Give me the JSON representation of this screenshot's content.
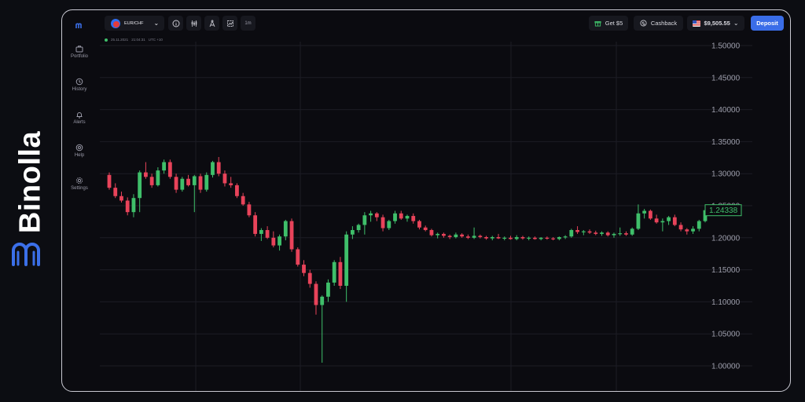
{
  "brand": {
    "word": "Binolla",
    "accent": "#3b6fe8"
  },
  "sidebar": {
    "items": [
      {
        "label": "Portfolio",
        "icon": "briefcase-icon"
      },
      {
        "label": "History",
        "icon": "history-icon"
      },
      {
        "label": "Alerts",
        "icon": "bell-icon"
      },
      {
        "label": "Help",
        "icon": "help-icon"
      },
      {
        "label": "Settings",
        "icon": "gear-icon"
      }
    ]
  },
  "topbar": {
    "pair": "EUR/CHF",
    "timeframe": "1m",
    "get_bonus": "Get $5",
    "cashback": "Cashback",
    "balance": "$9,505.55",
    "deposit": "Deposit"
  },
  "chart_header": {
    "date": "25.11.2021",
    "time": "21:04:31",
    "timezone": "UTC +10"
  },
  "chart_data": {
    "type": "candlestick",
    "y_ticks": [
      "1.50000",
      "1.45000",
      "1.40000",
      "1.35000",
      "1.30000",
      "1.25000",
      "1.20000",
      "1.15000",
      "1.10000",
      "1.05000",
      "1.00000"
    ],
    "ylim": [
      0.99,
      1.51
    ],
    "current_price": "1.24338",
    "colors": {
      "up": "#3fbf6a",
      "down": "#e8435a",
      "grid": "#1c1d25"
    },
    "candles": [
      [
        1.298,
        1.302,
        1.275,
        1.278
      ],
      [
        1.278,
        1.285,
        1.262,
        1.265
      ],
      [
        1.265,
        1.272,
        1.255,
        1.258
      ],
      [
        1.258,
        1.263,
        1.235,
        1.24
      ],
      [
        1.24,
        1.268,
        1.232,
        1.262
      ],
      [
        1.262,
        1.305,
        1.24,
        1.302
      ],
      [
        1.302,
        1.318,
        1.292,
        1.295
      ],
      [
        1.295,
        1.3,
        1.278,
        1.282
      ],
      [
        1.282,
        1.31,
        1.28,
        1.305
      ],
      [
        1.305,
        1.322,
        1.3,
        1.318
      ],
      [
        1.318,
        1.322,
        1.292,
        1.295
      ],
      [
        1.295,
        1.3,
        1.27,
        1.275
      ],
      [
        1.275,
        1.295,
        1.272,
        1.292
      ],
      [
        1.292,
        1.298,
        1.28,
        1.282
      ],
      [
        1.282,
        1.298,
        1.24,
        1.296
      ],
      [
        1.296,
        1.3,
        1.27,
        1.275
      ],
      [
        1.275,
        1.302,
        1.272,
        1.298
      ],
      [
        1.298,
        1.32,
        1.294,
        1.318
      ],
      [
        1.318,
        1.326,
        1.296,
        1.3
      ],
      [
        1.3,
        1.305,
        1.28,
        1.285
      ],
      [
        1.285,
        1.295,
        1.278,
        1.282
      ],
      [
        1.282,
        1.285,
        1.262,
        1.265
      ],
      [
        1.265,
        1.27,
        1.25,
        1.252
      ],
      [
        1.252,
        1.256,
        1.232,
        1.235
      ],
      [
        1.235,
        1.24,
        1.202,
        1.206
      ],
      [
        1.206,
        1.215,
        1.195,
        1.212
      ],
      [
        1.212,
        1.218,
        1.198,
        1.2
      ],
      [
        1.2,
        1.21,
        1.185,
        1.188
      ],
      [
        1.188,
        1.205,
        1.18,
        1.202
      ],
      [
        1.202,
        1.228,
        1.196,
        1.226
      ],
      [
        1.226,
        1.23,
        1.178,
        1.182
      ],
      [
        1.182,
        1.185,
        1.155,
        1.158
      ],
      [
        1.158,
        1.165,
        1.14,
        1.145
      ],
      [
        1.145,
        1.15,
        1.122,
        1.128
      ],
      [
        1.128,
        1.132,
        1.08,
        1.095
      ],
      [
        1.095,
        1.11,
        1.005,
        1.108
      ],
      [
        1.108,
        1.135,
        1.1,
        1.13
      ],
      [
        1.13,
        1.165,
        1.125,
        1.162
      ],
      [
        1.162,
        1.17,
        1.12,
        1.125
      ],
      [
        1.125,
        1.21,
        1.1,
        1.205
      ],
      [
        1.205,
        1.218,
        1.198,
        1.212
      ],
      [
        1.212,
        1.222,
        1.208,
        1.22
      ],
      [
        1.22,
        1.24,
        1.205,
        1.235
      ],
      [
        1.235,
        1.242,
        1.225,
        1.238
      ],
      [
        1.238,
        1.24,
        1.226,
        1.232
      ],
      [
        1.232,
        1.236,
        1.21,
        1.215
      ],
      [
        1.215,
        1.228,
        1.212,
        1.226
      ],
      [
        1.226,
        1.242,
        1.222,
        1.238
      ],
      [
        1.238,
        1.242,
        1.228,
        1.23
      ],
      [
        1.23,
        1.236,
        1.225,
        1.234
      ],
      [
        1.234,
        1.238,
        1.222,
        1.226
      ],
      [
        1.226,
        1.228,
        1.213,
        1.216
      ],
      [
        1.216,
        1.219,
        1.21,
        1.212
      ],
      [
        1.212,
        1.214,
        1.202,
        1.204
      ],
      [
        1.204,
        1.208,
        1.199,
        1.206
      ],
      [
        1.206,
        1.208,
        1.2,
        1.203
      ],
      [
        1.203,
        1.205,
        1.198,
        1.201
      ],
      [
        1.201,
        1.208,
        1.199,
        1.205
      ],
      [
        1.205,
        1.207,
        1.2,
        1.202
      ],
      [
        1.202,
        1.205,
        1.198,
        1.2
      ],
      [
        1.2,
        1.216,
        1.198,
        1.203
      ],
      [
        1.203,
        1.205,
        1.199,
        1.201
      ],
      [
        1.201,
        1.203,
        1.197,
        1.199
      ],
      [
        1.199,
        1.203,
        1.196,
        1.201
      ],
      [
        1.201,
        1.206,
        1.198,
        1.199
      ],
      [
        1.199,
        1.202,
        1.196,
        1.2
      ],
      [
        1.2,
        1.203,
        1.197,
        1.198
      ],
      [
        1.198,
        1.204,
        1.196,
        1.201
      ],
      [
        1.201,
        1.203,
        1.197,
        1.199
      ],
      [
        1.199,
        1.202,
        1.196,
        1.2
      ],
      [
        1.2,
        1.202,
        1.197,
        1.198
      ],
      [
        1.198,
        1.201,
        1.196,
        1.2
      ],
      [
        1.2,
        1.202,
        1.197,
        1.199
      ],
      [
        1.199,
        1.201,
        1.196,
        1.198
      ],
      [
        1.198,
        1.202,
        1.196,
        1.201
      ],
      [
        1.201,
        1.204,
        1.198,
        1.202
      ],
      [
        1.202,
        1.214,
        1.2,
        1.212
      ],
      [
        1.212,
        1.218,
        1.206,
        1.209
      ],
      [
        1.209,
        1.212,
        1.204,
        1.21
      ],
      [
        1.21,
        1.213,
        1.206,
        1.208
      ],
      [
        1.208,
        1.211,
        1.204,
        1.206
      ],
      [
        1.206,
        1.21,
        1.203,
        1.208
      ],
      [
        1.208,
        1.21,
        1.202,
        1.204
      ],
      [
        1.204,
        1.208,
        1.2,
        1.206
      ],
      [
        1.206,
        1.216,
        1.203,
        1.207
      ],
      [
        1.207,
        1.21,
        1.203,
        1.205
      ],
      [
        1.205,
        1.216,
        1.203,
        1.214
      ],
      [
        1.214,
        1.252,
        1.212,
        1.238
      ],
      [
        1.238,
        1.245,
        1.23,
        1.242
      ],
      [
        1.242,
        1.244,
        1.228,
        1.23
      ],
      [
        1.23,
        1.236,
        1.222,
        1.224
      ],
      [
        1.224,
        1.23,
        1.21,
        1.226
      ],
      [
        1.226,
        1.234,
        1.22,
        1.232
      ],
      [
        1.232,
        1.236,
        1.218,
        1.22
      ],
      [
        1.22,
        1.224,
        1.21,
        1.213
      ],
      [
        1.213,
        1.215,
        1.205,
        1.21
      ],
      [
        1.21,
        1.218,
        1.206,
        1.214
      ],
      [
        1.214,
        1.228,
        1.21,
        1.226
      ],
      [
        1.226,
        1.245,
        1.224,
        1.243
      ]
    ]
  }
}
